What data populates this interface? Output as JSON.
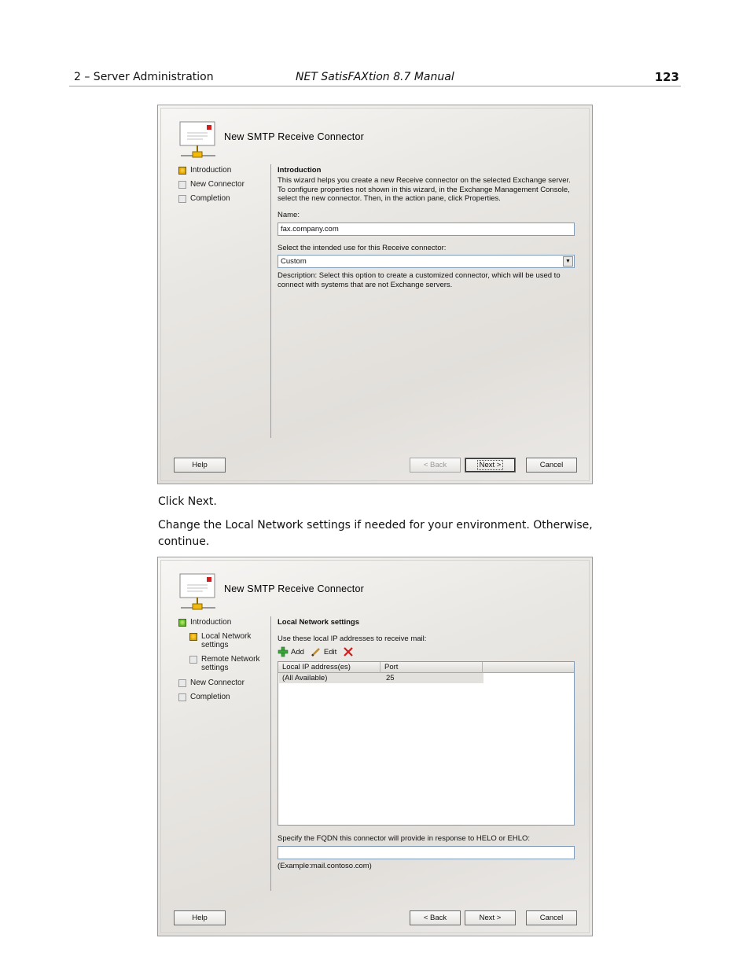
{
  "header": {
    "chapter": "2 – Server Administration",
    "manual_title": "NET SatisFAXtion 8.7 Manual",
    "page_number": "123"
  },
  "instructions": {
    "click_next": "Click Next.",
    "change_settings": "Change the Local Network settings if needed for your environment. Otherwise, continue."
  },
  "wizard1": {
    "title": "New SMTP Receive Connector",
    "nav": [
      "Introduction",
      "New Connector",
      "Completion"
    ],
    "section_heading": "Introduction",
    "intro_lines": [
      "This wizard helps you create a new Receive connector on the selected Exchange server.",
      "To configure properties not shown in this wizard, in the Exchange Management Console,",
      "select the new connector. Then, in the action pane, click Properties."
    ],
    "name_label": "Name:",
    "name_value": "fax.company.com",
    "use_label": "Select the intended use for this Receive connector:",
    "use_value": "Custom",
    "description_lines": [
      "Description: Select this option to create a customized connector, which will be used to",
      "connect with systems that are not Exchange servers."
    ],
    "buttons": {
      "help": "Help",
      "back": "< Back",
      "next": "Next >",
      "cancel": "Cancel"
    }
  },
  "wizard2": {
    "title": "New SMTP Receive Connector",
    "nav": [
      "Introduction",
      "Local Network settings",
      "Remote Network settings",
      "New Connector",
      "Completion"
    ],
    "section_heading": "Local Network settings",
    "use_label": "Use these local IP addresses to receive mail:",
    "toolbar": {
      "add": "Add",
      "edit": "Edit"
    },
    "columns": [
      "Local IP address(es)",
      "Port"
    ],
    "rows": [
      {
        "address": "(All Available)",
        "port": "25"
      }
    ],
    "fqdn_label": "Specify the FQDN this connector will provide in response to HELO or EHLO:",
    "fqdn_value": "",
    "example": "(Example:mail.contoso.com)",
    "buttons": {
      "help": "Help",
      "back": "< Back",
      "next": "Next >",
      "cancel": "Cancel"
    }
  },
  "colors": {
    "active_step": "#e0a400",
    "done_step": "#5fb31f",
    "delete_icon": "#d21c1c",
    "add_icon": "#3aa53a"
  }
}
